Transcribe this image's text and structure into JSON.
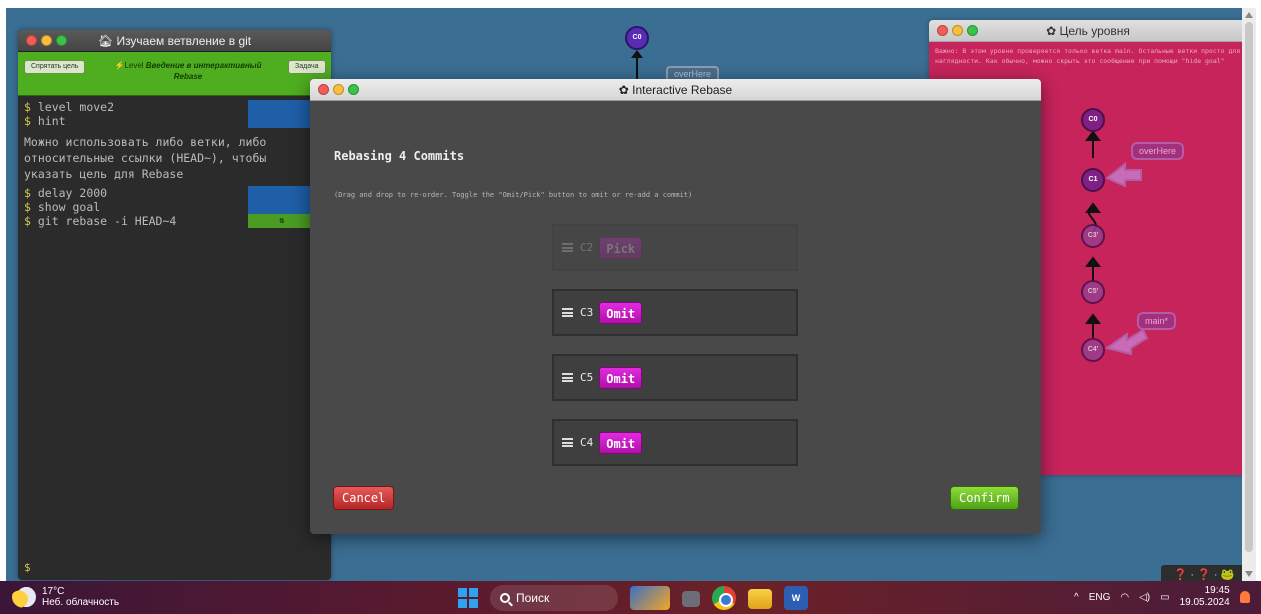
{
  "terminal": {
    "title": "Изучаем ветвление в git",
    "hide_goal_label": "Спрятать цель",
    "task_label": "Задача",
    "level_prefix": "Level",
    "level_name": "Введение в интерактивный Rebase",
    "lines": [
      {
        "cmd": "level move2",
        "badge": "⊡"
      },
      {
        "cmd": "hint",
        "badge": "⊡"
      }
    ],
    "message": "Можно использовать либо ветки, либо\nотносительные ссылки (HEAD~), чтобы\nуказать цель для Rebase",
    "lines2": [
      {
        "cmd": "delay 2000",
        "badge": "⊡"
      },
      {
        "cmd": "show goal",
        "badge": "⊡"
      },
      {
        "cmd": "git rebase -i HEAD~4",
        "badge": "⇅"
      }
    ],
    "prompt": "$"
  },
  "bg_tree": {
    "node": "C0",
    "branch": "overHere"
  },
  "goal_window": {
    "title": "Цель уровня",
    "message": "Важно: В этом уровне проверяется только ветка main. Остальные ветки просто для наглядности. Как обычно, можно скрыть это сообщение при помощи \"hide goal\"",
    "nodes": [
      "C0",
      "C1",
      "C3'",
      "C5'",
      "C4'"
    ],
    "branches": [
      "overHere",
      "main*"
    ]
  },
  "modal": {
    "title": "Interactive Rebase",
    "heading": "Rebasing 4 Commits",
    "hint": "(Drag and drop to re-order. Toggle the \"Omit/Pick\" button to omit or re-add a commit)",
    "commits": [
      {
        "id": "C2",
        "button": "Pick",
        "omitted": true
      },
      {
        "id": "C3",
        "button": "Omit",
        "omitted": false
      },
      {
        "id": "C5",
        "button": "Omit",
        "omitted": false
      },
      {
        "id": "C4",
        "button": "Omit",
        "omitted": false
      }
    ],
    "cancel_label": "Cancel",
    "confirm_label": "Confirm"
  },
  "help_bar": {
    "text": "❓ · ❓ · 🐸"
  },
  "taskbar": {
    "temperature": "17°C",
    "weather": "Неб. облачность",
    "search_placeholder": "Поиск",
    "lang": "ENG",
    "time": "19:45",
    "date": "19.05.2024"
  },
  "colors": {
    "viewport_bg": "#3b6e93",
    "goal_bg": "#c7245c",
    "omit_button": "#d21ed0",
    "confirm": "#6cc024",
    "cancel": "#d03a3a"
  }
}
